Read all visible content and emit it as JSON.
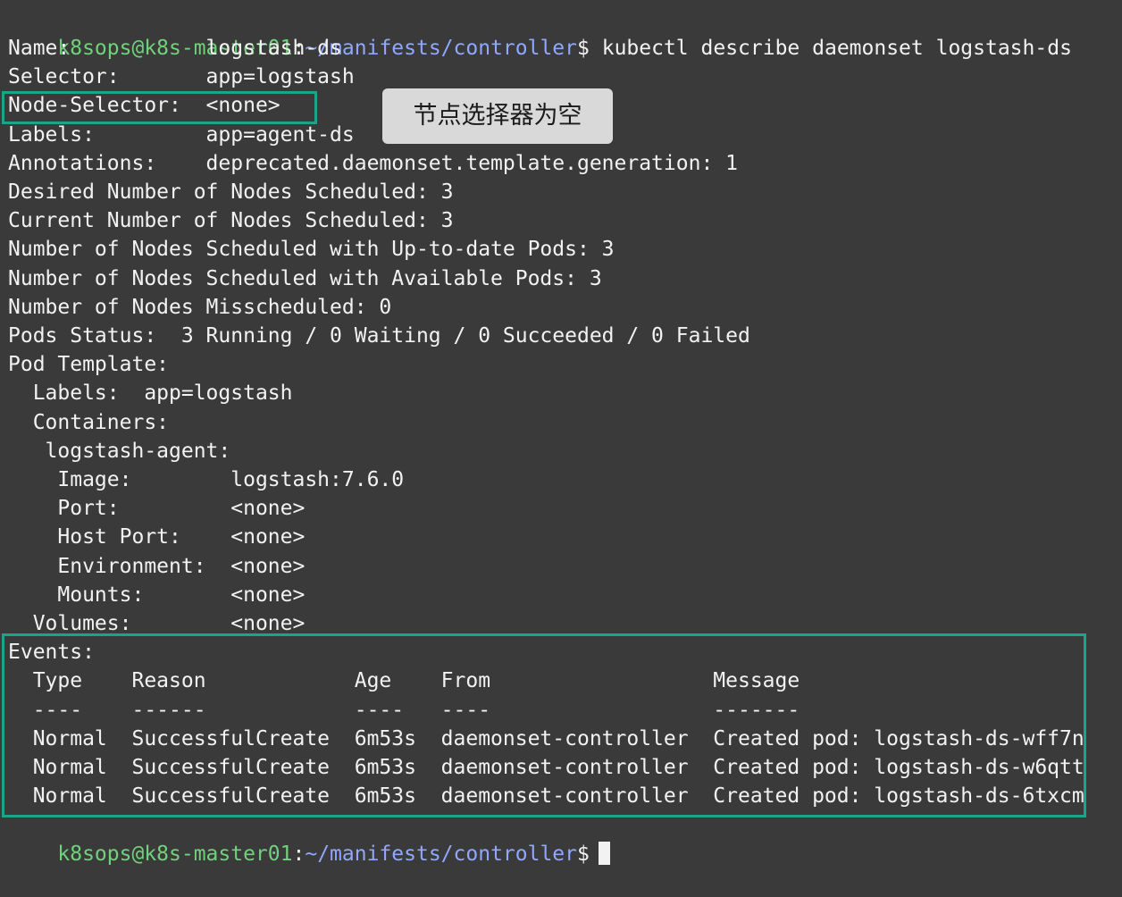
{
  "prompt": {
    "user_host": "k8sops@k8s-master01",
    "separator": ":",
    "path": "~/manifests/controller",
    "symbol": "$"
  },
  "command": "kubectl describe daemonset logstash-ds",
  "callout_text": "节点选择器为空",
  "output_lines": [
    "Name:           logstash-ds",
    "Selector:       app=logstash",
    "Node-Selector:  <none>",
    "Labels:         app=agent-ds",
    "Annotations:    deprecated.daemonset.template.generation: 1",
    "Desired Number of Nodes Scheduled: 3",
    "Current Number of Nodes Scheduled: 3",
    "Number of Nodes Scheduled with Up-to-date Pods: 3",
    "Number of Nodes Scheduled with Available Pods: 3",
    "Number of Nodes Misscheduled: 0",
    "Pods Status:  3 Running / 0 Waiting / 0 Succeeded / 0 Failed",
    "Pod Template:",
    "  Labels:  app=logstash",
    "  Containers:",
    "   logstash-agent:",
    "    Image:        logstash:7.6.0",
    "    Port:         <none>",
    "    Host Port:    <none>",
    "    Environment:  <none>",
    "    Mounts:       <none>",
    "  Volumes:        <none>",
    "Events:",
    "  Type    Reason            Age    From                  Message",
    "  ----    ------            ----   ----                  -------",
    "  Normal  SuccessfulCreate  6m53s  daemonset-controller  Created pod: logstash-ds-wff7n",
    "  Normal  SuccessfulCreate  6m53s  daemonset-controller  Created pod: logstash-ds-w6qtt",
    "  Normal  SuccessfulCreate  6m53s  daemonset-controller  Created pod: logstash-ds-6txcm"
  ],
  "colors": {
    "background": "#3a3a3a",
    "text": "#f2f2f2",
    "prompt_user": "#72d17c",
    "prompt_path": "#8fa7ff",
    "highlight": "#18a58a",
    "callout_bg": "#d9d9d9"
  }
}
